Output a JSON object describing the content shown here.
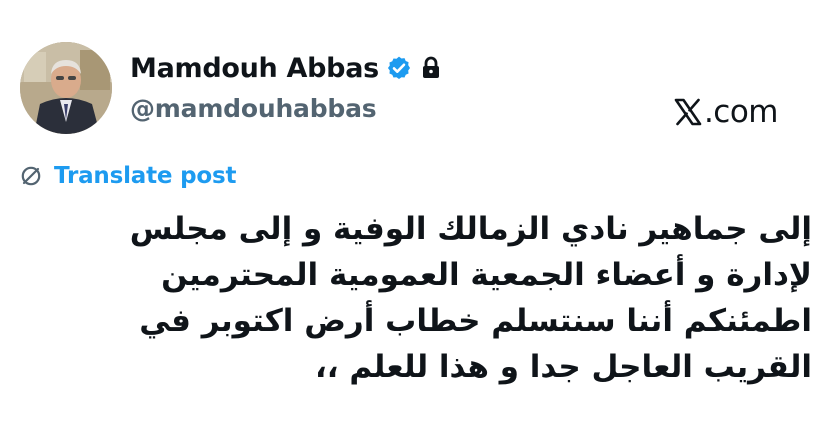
{
  "author": {
    "display_name": "Mamdouh Abbas",
    "handle": "@mamdouhabbas",
    "verified": true,
    "protected": true,
    "avatar_icon": "avatar-photo"
  },
  "brand": {
    "text": ".com",
    "logo_icon": "x-logo-icon"
  },
  "translate": {
    "label": "Translate post",
    "icon": "translate-globe-icon",
    "color": "#1d9bf0"
  },
  "post": {
    "text": "إلى جماهير نادي الزمالك الوفية و إلى مجلس\nلإدارة و أعضاء الجمعية العمومية المحترمين\nاطمئنكم أننا سنتسلم خطاب أرض اكتوبر في\nالقريب العاجل جدا و هذا  للعلم ،،"
  },
  "colors": {
    "text_primary": "#0f1419",
    "text_secondary": "#536471",
    "verified_badge": "#1d9bf0"
  }
}
